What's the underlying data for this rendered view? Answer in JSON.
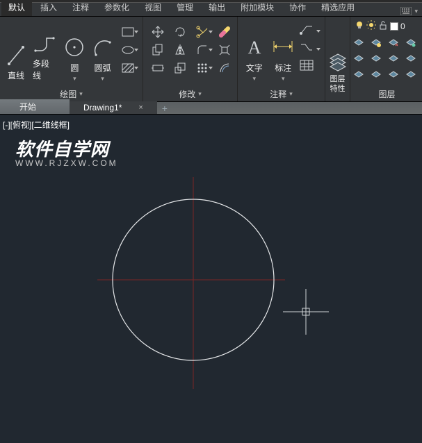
{
  "tabs": {
    "active": "默认",
    "items": [
      "默认",
      "插入",
      "注释",
      "参数化",
      "视图",
      "管理",
      "输出",
      "附加模块",
      "协作",
      "精选应用"
    ]
  },
  "panels": {
    "draw": {
      "title": "绘图",
      "line": "直线",
      "polyline": "多段线",
      "circle": "圆",
      "arc": "圆弧"
    },
    "modify": {
      "title": "修改"
    },
    "annotation": {
      "title": "注释",
      "text": "文字",
      "dim": "标注"
    },
    "layers": {
      "title": "图层",
      "props": "图层",
      "props2": "特性"
    },
    "layers2": {
      "title": "图层"
    }
  },
  "counter": "0",
  "doctabs": {
    "start": "开始",
    "drawing": "Drawing1*",
    "close": "×",
    "plus": "+"
  },
  "view": {
    "label": "[-][俯视][二维线框]"
  },
  "watermark": {
    "line1": "软件自学网",
    "line2": "WWW.RJZXW.COM"
  }
}
